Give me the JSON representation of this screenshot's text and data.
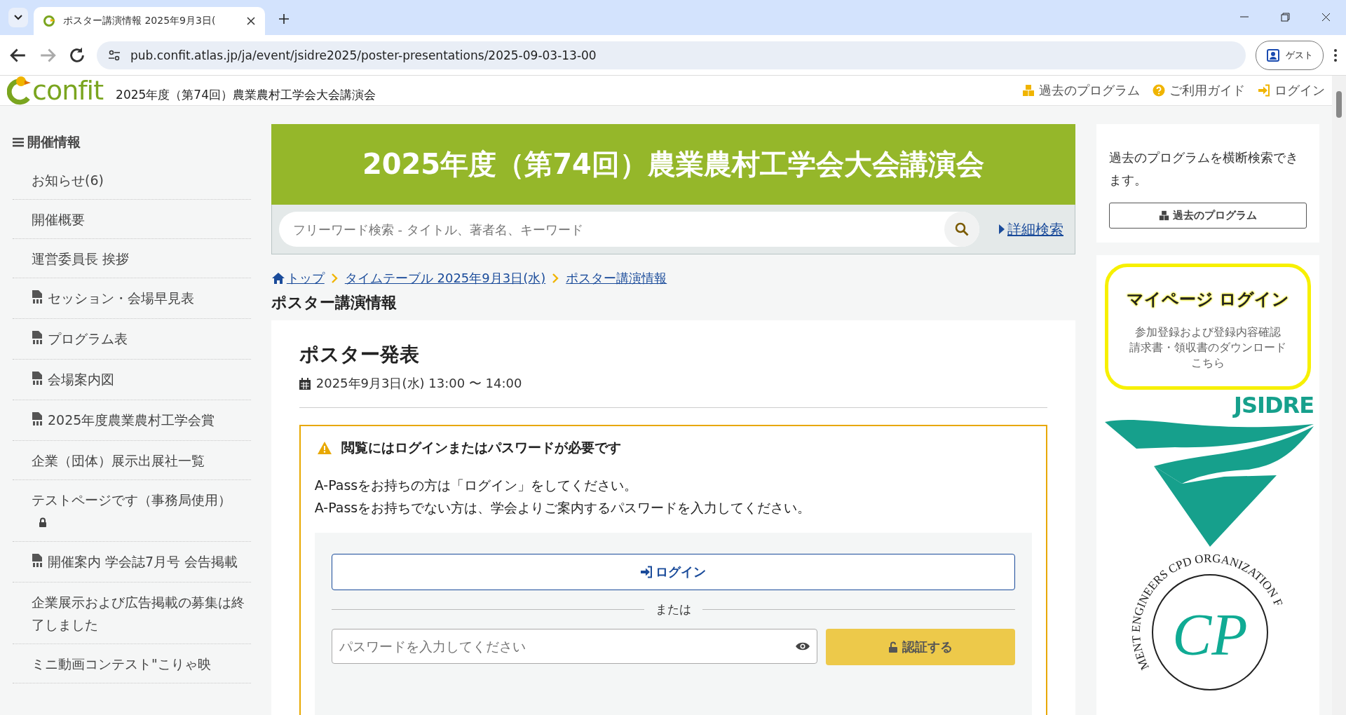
{
  "browser": {
    "tab_title": "ポスター講演情報 2025年9月3日(",
    "url": "pub.confit.atlas.jp/ja/event/jsidre2025/poster-presentations/2025-09-03-13-00",
    "profile": "ゲスト"
  },
  "header": {
    "logo": "confit",
    "site_title": "2025年度（第74回）農業農村工学会大会講演会",
    "links": [
      {
        "label": "過去のプログラム",
        "kind": "archive"
      },
      {
        "label": "ご利用ガイド",
        "kind": "help"
      },
      {
        "label": "ログイン",
        "kind": "login"
      }
    ]
  },
  "sidebar": {
    "title": "開催情報",
    "items": [
      {
        "label": "お知らせ(6)",
        "kind": "page"
      },
      {
        "label": "開催概要",
        "kind": "page"
      },
      {
        "label": "運営委員長 挨拶",
        "kind": "page"
      },
      {
        "label": "セッション・会場早見表",
        "kind": "pdf"
      },
      {
        "label": "プログラム表",
        "kind": "pdf"
      },
      {
        "label": "会場案内図",
        "kind": "pdf"
      },
      {
        "label": "2025年度農業農村工学会賞",
        "kind": "pdf"
      },
      {
        "label": "企業（団体）展示出展社一覧",
        "kind": "page"
      },
      {
        "label": "テストページです（事務局使用）",
        "kind": "locked"
      },
      {
        "label": "開催案内 学会誌7月号 会告掲載",
        "kind": "pdf"
      },
      {
        "label": "企業展示および広告掲載の募集は終了しました",
        "kind": "page"
      },
      {
        "label": "ミニ動画コンテスト\"こりゃ映",
        "kind": "page"
      }
    ]
  },
  "banner": {
    "title": "2025年度（第74回）農業農村工学会大会講演会"
  },
  "search": {
    "placeholder": "フリーワード検索 - タイトル、著者名、キーワード",
    "advanced": "詳細検索"
  },
  "breadcrumb": [
    {
      "label": "トップ",
      "kind": "home"
    },
    {
      "label": "タイムテーブル 2025年9月3日(水)",
      "kind": "link"
    },
    {
      "label": "ポスター講演情報",
      "kind": "link"
    }
  ],
  "page_heading": "ポスター講演情報",
  "session": {
    "title": "ポスター発表",
    "datetime": "2025年9月3日(水) 13:00 〜 14:00"
  },
  "notice": {
    "title": "閲覧にはログインまたはパスワードが必要です",
    "lines": [
      "A-Passをお持ちの方は「ログイン」をしてください。",
      "A-Passをお持ちでない方は、学会よりご案内するパスワードを入力してください。"
    ],
    "login_button": "ログイン",
    "divider": "または",
    "password": {
      "placeholder": "パスワードを入力してください"
    },
    "verify_button": "認証する"
  },
  "right": {
    "text": "過去のプログラムを横断検索できます。",
    "button": "過去のプログラム",
    "mypage": {
      "title": "マイページ ログイン",
      "lines": [
        "参加登録および登録内容確認",
        "請求書・領収書のダウンロード",
        "こちら"
      ]
    },
    "jsidre": "JSIDRE",
    "cpd": {
      "ring": "MENT ENGINEERS CPD ORGANIZATION F",
      "letters": "CP"
    }
  }
}
